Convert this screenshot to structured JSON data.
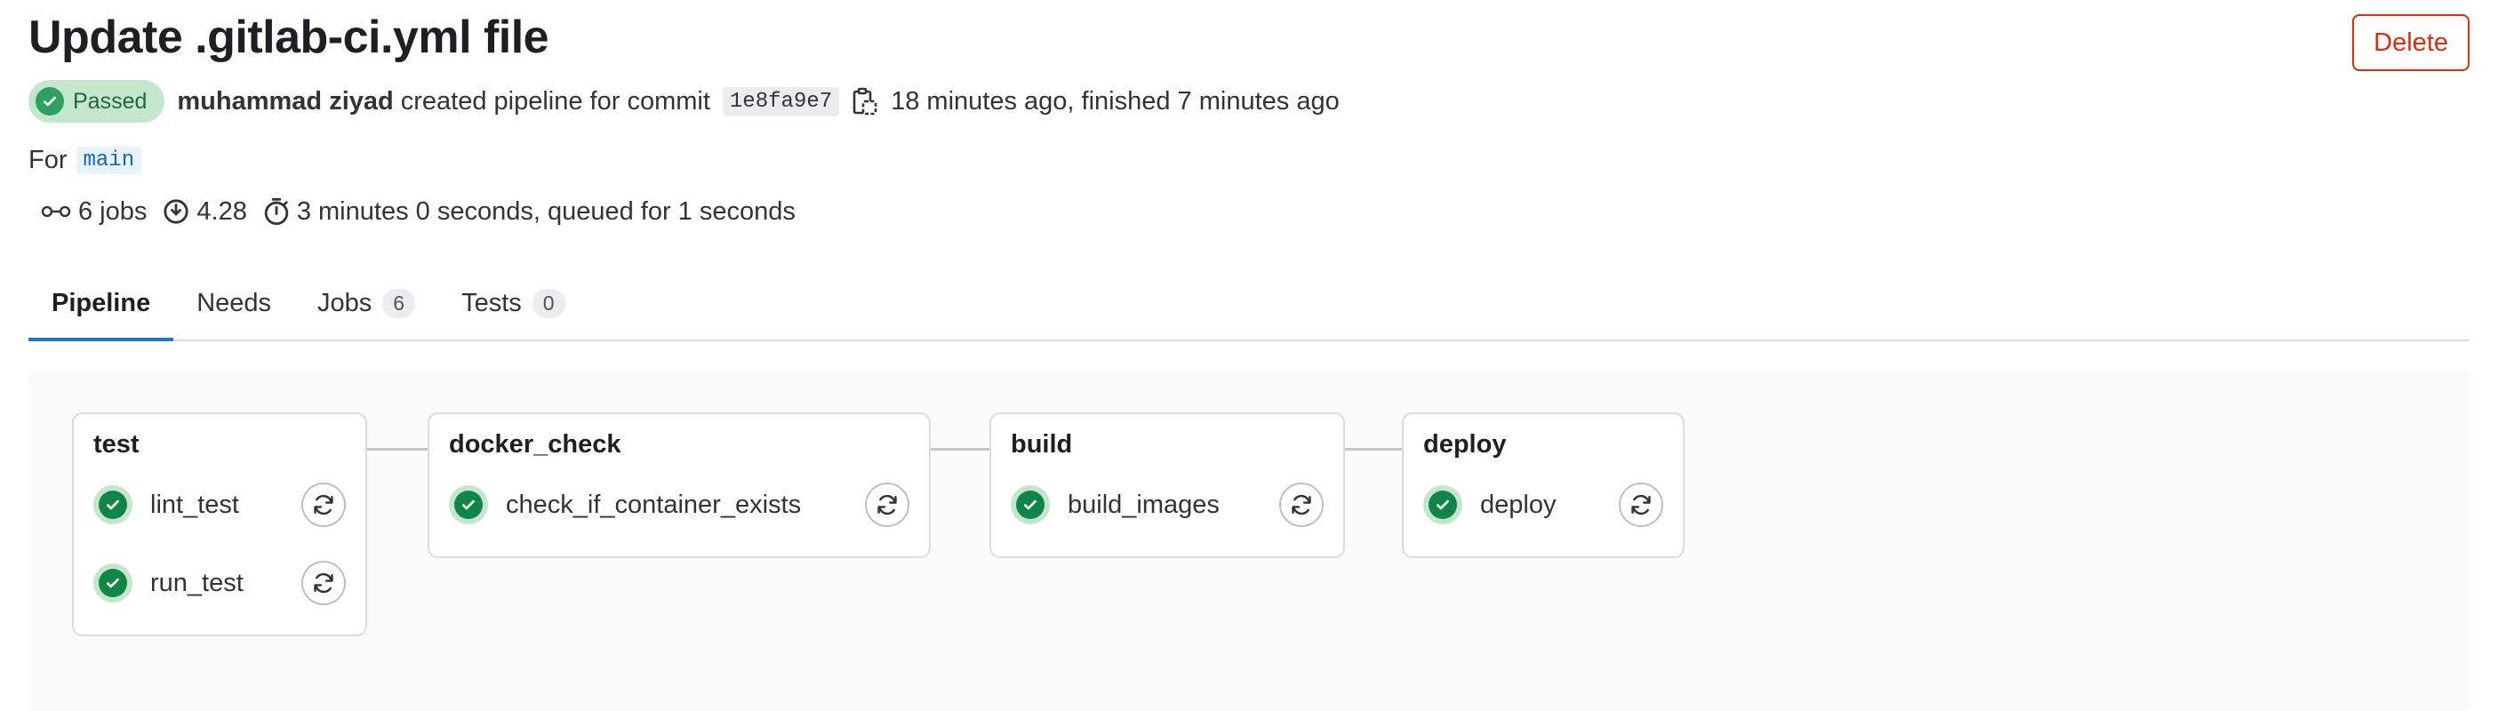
{
  "header": {
    "title": "Update .gitlab-ci.yml file",
    "delete_label": "Delete"
  },
  "meta": {
    "status": "Passed",
    "author": "muhammad ziyad",
    "action_text": "created pipeline for commit",
    "commit_sha": "1e8fa9e7",
    "timing_text": "18 minutes ago, finished 7 minutes ago"
  },
  "ref": {
    "prefix": "For",
    "branch": "main"
  },
  "stats": {
    "jobs": "6 jobs",
    "compute": "4.28",
    "duration": "3 minutes 0 seconds, queued for 1 seconds"
  },
  "tabs": [
    {
      "label": "Pipeline",
      "count": ""
    },
    {
      "label": "Needs",
      "count": ""
    },
    {
      "label": "Jobs",
      "count": "6"
    },
    {
      "label": "Tests",
      "count": "0"
    }
  ],
  "stages": [
    {
      "name": "test",
      "jobs": [
        "lint_test",
        "run_test"
      ]
    },
    {
      "name": "docker_check",
      "jobs": [
        "check_if_container_exists"
      ]
    },
    {
      "name": "build",
      "jobs": [
        "build_images"
      ]
    },
    {
      "name": "deploy",
      "jobs": [
        "deploy"
      ]
    }
  ],
  "colors": {
    "success": "#108548",
    "danger": "#dd2b0e",
    "tab_active": "#1f75cb"
  },
  "icons": {
    "copy": "copy-icon",
    "jobs": "pipeline-icon",
    "compute": "compute-icon",
    "duration": "timer-icon",
    "retry": "retry-icon",
    "status": "check-circle-icon"
  }
}
